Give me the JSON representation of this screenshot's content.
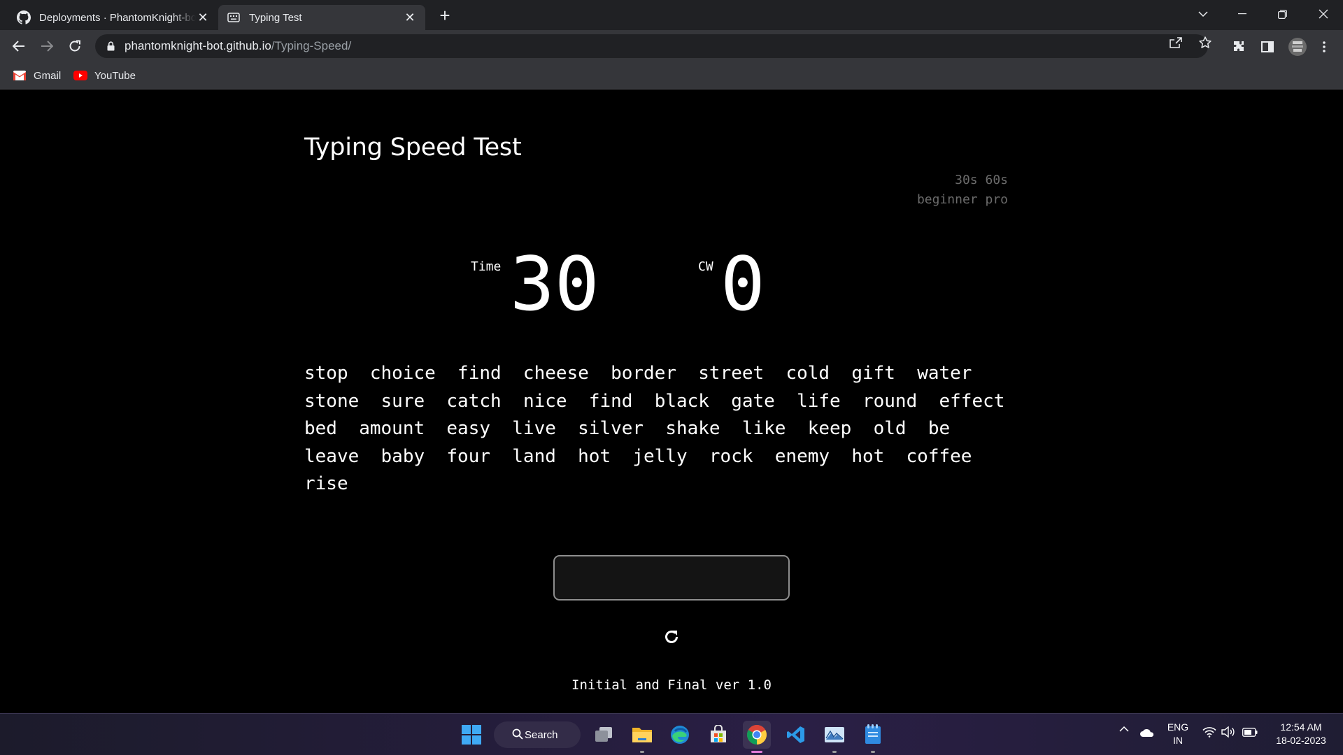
{
  "browser": {
    "tabs": [
      {
        "title": "Deployments · PhantomKnight-bot/Typing-Speed",
        "favicon": "github-icon",
        "active": false
      },
      {
        "title": "Typing Test",
        "favicon": "keyboard-icon",
        "active": true
      }
    ],
    "address": {
      "host": "phantomknight-bot.github.io",
      "path": "/Typing-Speed/"
    },
    "bookmarks": [
      {
        "label": "Gmail",
        "icon": "gmail-icon"
      },
      {
        "label": "YouTube",
        "icon": "youtube-icon"
      }
    ]
  },
  "app": {
    "title": "Typing Speed Test",
    "time_options": [
      "30s",
      "60s"
    ],
    "level_options": [
      "beginner",
      "pro"
    ],
    "stats": {
      "time_label": "Time",
      "time_value": "30",
      "cw_label": "CW",
      "cw_value": "0"
    },
    "words": [
      "stop",
      "choice",
      "find",
      "cheese",
      "border",
      "street",
      "cold",
      "gift",
      "water",
      "stone",
      "sure",
      "catch",
      "nice",
      "find",
      "black",
      "gate",
      "life",
      "round",
      "effect",
      "bed",
      "amount",
      "easy",
      "live",
      "silver",
      "shake",
      "like",
      "keep",
      "old",
      "be",
      "leave",
      "baby",
      "four",
      "land",
      "hot",
      "jelly",
      "rock",
      "enemy",
      "hot",
      "coffee",
      "rise"
    ],
    "input_value": "",
    "reset_icon": "refresh-icon",
    "footer": "Initial and Final ver 1.0"
  },
  "taskbar": {
    "search_label": "Search",
    "apps": [
      "windows-start-icon",
      "task-view-icon",
      "file-explorer-icon",
      "edge-icon",
      "microsoft-store-icon",
      "chrome-icon",
      "vscode-icon",
      "photos-icon",
      "notepad-icon"
    ],
    "language": {
      "line1": "ENG",
      "line2": "IN"
    },
    "clock": {
      "time": "12:54 AM",
      "date": "18-02-2023"
    }
  },
  "colors": {
    "page_bg": "#000000",
    "muted_text": "#6b6b6b",
    "input_border": "#8e8e8e",
    "chrome_dark": "#202124",
    "chrome_mid": "#35363a"
  }
}
